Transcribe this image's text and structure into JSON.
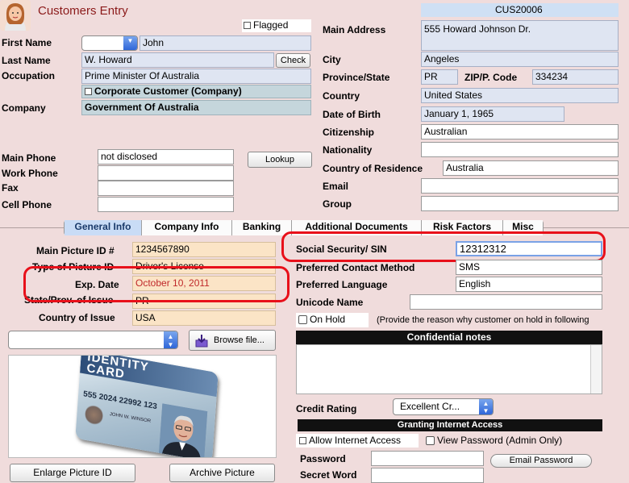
{
  "header": {
    "title": "Customers Entry",
    "customer_id": "CUS20006",
    "flagged_label": "Flagged"
  },
  "left": {
    "first_name_label": "First Name",
    "first_name": "John",
    "last_name_label": "Last Name",
    "last_name": "W. Howard",
    "check_label": "Check",
    "occupation_label": "Occupation",
    "occupation": "Prime Minister Of Australia",
    "corporate_label": "Corporate Customer (Company)",
    "company_label": "Company",
    "company": "Government Of Australia",
    "main_phone_label": "Main Phone",
    "main_phone": "not disclosed",
    "lookup_label": "Lookup",
    "work_phone_label": "Work Phone",
    "fax_label": "Fax",
    "cell_phone_label": "Cell Phone"
  },
  "right": {
    "main_address_label": "Main Address",
    "main_address": "555 Howard Johnson Dr.",
    "city_label": "City",
    "city": "Angeles",
    "province_label": "Province/State",
    "province": "PR",
    "zip_label": "ZIP/P. Code",
    "zip": "334234",
    "country_label": "Country",
    "country": "United States",
    "dob_label": "Date of Birth",
    "dob": "January 1, 1965",
    "citizenship_label": "Citizenship",
    "citizenship": "Australian",
    "nationality_label": "Nationality",
    "residence_label": "Country of Residence",
    "residence": "Australia",
    "email_label": "Email",
    "group_label": "Group"
  },
  "tabs": [
    "General Info",
    "Company Info",
    "Banking",
    "Additional Documents",
    "Risk Factors",
    "Misc"
  ],
  "general": {
    "main_picture_label": "Main Picture ID #",
    "main_picture": "1234567890",
    "type_label": "Type of Picture ID",
    "type": "Driver's License",
    "exp_label": "Exp. Date",
    "exp": "October 10, 2011",
    "state_label": "State/Prov. of Issue",
    "state": "PR",
    "country_issue_label": "Country of Issue",
    "country_issue": "USA",
    "browse_label": "Browse file...",
    "enlarge_label": "Enlarge Picture ID",
    "archive_label": "Archive Picture",
    "id_card": {
      "title_line1": "IDENTITY",
      "title_line2": "CARD",
      "number": "555 2024 22992 123",
      "holder": "JOHN W. WINSOR"
    },
    "ssn_label": "Social Security/ SIN",
    "ssn": "12312312",
    "contact_label": "Preferred Contact Method",
    "contact": "SMS",
    "language_label": "Preferred Language",
    "language": "English",
    "unicode_label": "Unicode Name",
    "on_hold_label": "On Hold",
    "on_hold_note": "(Provide the reason why customer on hold in following",
    "confidential_label": "Confidential notes",
    "credit_label": "Credit Rating",
    "credit": "Excellent Cr...",
    "internet_header": "Granting Internet Access",
    "allow_internet_label": "Allow Internet Access",
    "view_password_label": "View Password (Admin Only)",
    "password_label": "Password",
    "email_password_label": "Email Password",
    "secret_label": "Secret Word"
  },
  "colors": {
    "background": "#f0dcdc",
    "title": "#8b1a1a",
    "highlight_red": "#e8101a",
    "tab_active": "#c9dcf6"
  }
}
